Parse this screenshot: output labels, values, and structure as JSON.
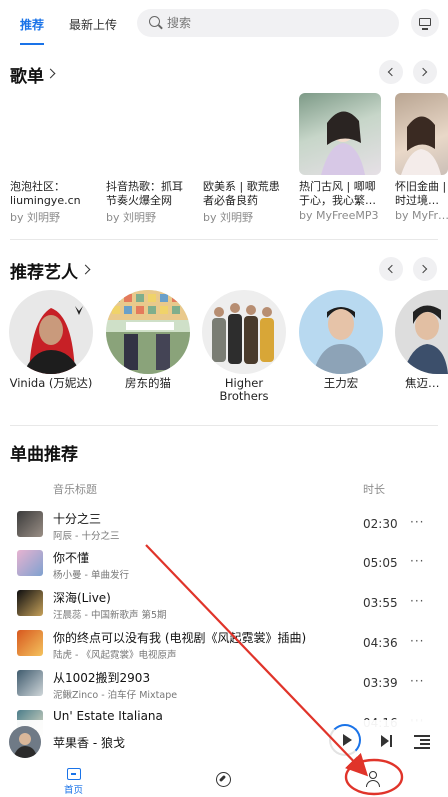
{
  "header": {
    "tabs": [
      {
        "label": "推荐",
        "active": true
      },
      {
        "label": "最新上传",
        "active": false
      }
    ],
    "search_placeholder": "搜索",
    "device_icon": "monitor-icon"
  },
  "playlists": {
    "title": "歌单",
    "items": [
      {
        "title": "泡泡社区：liumingye.cn",
        "by": "by 刘明野"
      },
      {
        "title": "抖音热歌：抓耳节奏火爆全网",
        "by": "by 刘明野"
      },
      {
        "title": "欧美系 | 歌荒患者必备良药",
        "by": "by 刘明野"
      },
      {
        "title": "热门古风 | 唧唧于心，我心繁…",
        "by": "by MyFreeMP3"
      },
      {
        "title": "怀旧金曲 | 时过境…",
        "by": "by MyFr…"
      }
    ]
  },
  "artists": {
    "title": "推荐艺人",
    "items": [
      {
        "name": "Vinida (万妮达)"
      },
      {
        "name": "房东的猫"
      },
      {
        "name": "Higher Brothers"
      },
      {
        "name": "王力宏"
      },
      {
        "name": "焦迈…"
      }
    ]
  },
  "songs": {
    "title": "单曲推荐",
    "col_title": "音乐标题",
    "col_duration": "时长",
    "items": [
      {
        "title": "十分之三",
        "sub": "阿辰 - 十分之三",
        "duration": "02:30",
        "more": "···"
      },
      {
        "title": "你不懂",
        "sub": "杨小曼 - 单曲发行",
        "duration": "05:05",
        "more": "···"
      },
      {
        "title": "深海(Live)",
        "sub": "汪晨蕊 - 中国新歌声 第5期",
        "duration": "03:55",
        "more": "···"
      },
      {
        "title": "你的终点可以没有我 (电视剧《风起霓裳》插曲)",
        "sub": "陆虎 - 《风起霓裳》电视原声",
        "duration": "04:36",
        "more": "···"
      },
      {
        "title": "从1002搬到2903",
        "sub": "泥鳅Zinco - 泊车仔 Mixtape",
        "duration": "03:39",
        "more": "···"
      },
      {
        "title": "Un' Estate Italiana",
        "sub": "",
        "duration": "04:16",
        "more": "···"
      }
    ]
  },
  "player": {
    "now_playing": "苹果香 - 狼戈"
  },
  "bottom_nav": {
    "home_label": "首页"
  },
  "colors": {
    "accent": "#1a73e8",
    "annotation": "#e0342a"
  }
}
